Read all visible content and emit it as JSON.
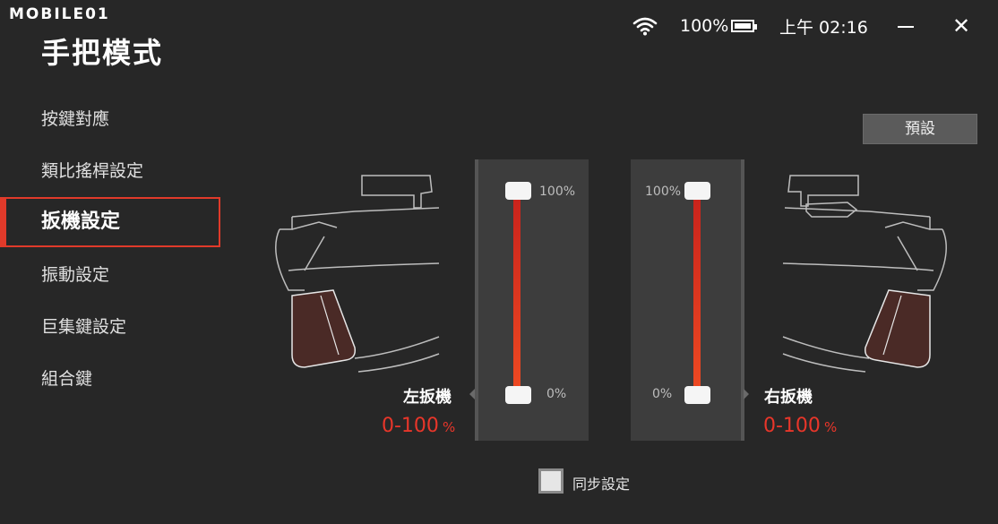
{
  "watermark": {
    "text": "MOBILE01"
  },
  "header": {
    "title": "手把模式"
  },
  "status_bar": {
    "battery": "100%",
    "time": "上午 02:16",
    "close_glyph": "✕"
  },
  "sidebar": {
    "items": [
      {
        "label": "按鍵對應"
      },
      {
        "label": "類比搖桿設定"
      },
      {
        "label": "扳機設定"
      },
      {
        "label": "振動設定"
      },
      {
        "label": "巨集鍵設定"
      },
      {
        "label": "組合鍵"
      }
    ]
  },
  "preset_button": {
    "label": "預設"
  },
  "left_trigger": {
    "label": "左扳機",
    "range": "0-100",
    "unit": "%",
    "top_tick": "100%",
    "bottom_tick": "0%",
    "min_value": 0,
    "max_value": 100
  },
  "right_trigger": {
    "label": "右扳機",
    "range": "0-100",
    "unit": "%",
    "top_tick": "100%",
    "bottom_tick": "0%",
    "min_value": 0,
    "max_value": 100
  },
  "sync": {
    "label": "同步設定",
    "checked": false
  },
  "colors": {
    "accent": "#e03a2a",
    "background": "#272727",
    "panel": "#3d3d3d",
    "trigger_fill": "#4a2a26"
  }
}
